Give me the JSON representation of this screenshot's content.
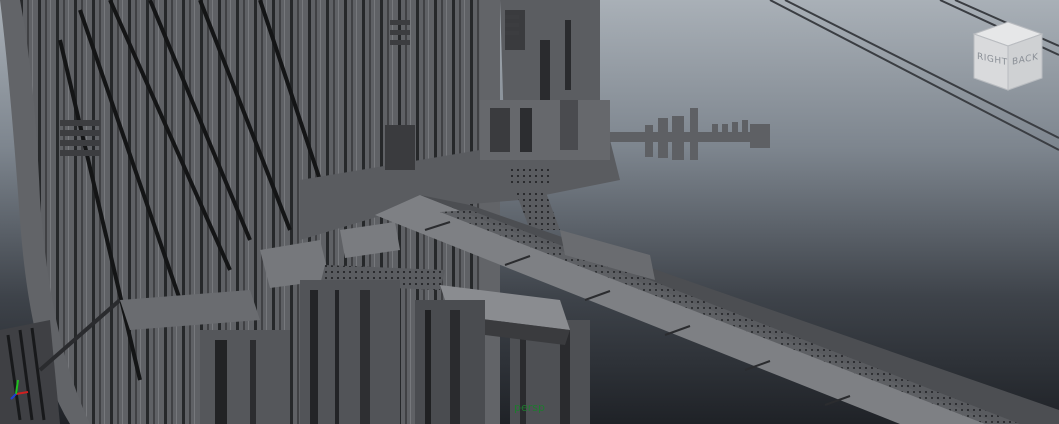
{
  "viewport": {
    "camera_name": "persp",
    "view_cube": {
      "face_right": "RIGHT",
      "face_back": "BACK"
    },
    "axis_indicator": [
      "x",
      "y",
      "z"
    ],
    "colors": {
      "sky_top": "#a9b0b7",
      "sky_bottom": "#1f2227",
      "geometry": "#6d6f73",
      "geometry_dark": "#2a2b2e",
      "camera_label": "#1e7a2e",
      "axis_x": "#d02020",
      "axis_y": "#20c020",
      "axis_z": "#2040d0"
    }
  }
}
